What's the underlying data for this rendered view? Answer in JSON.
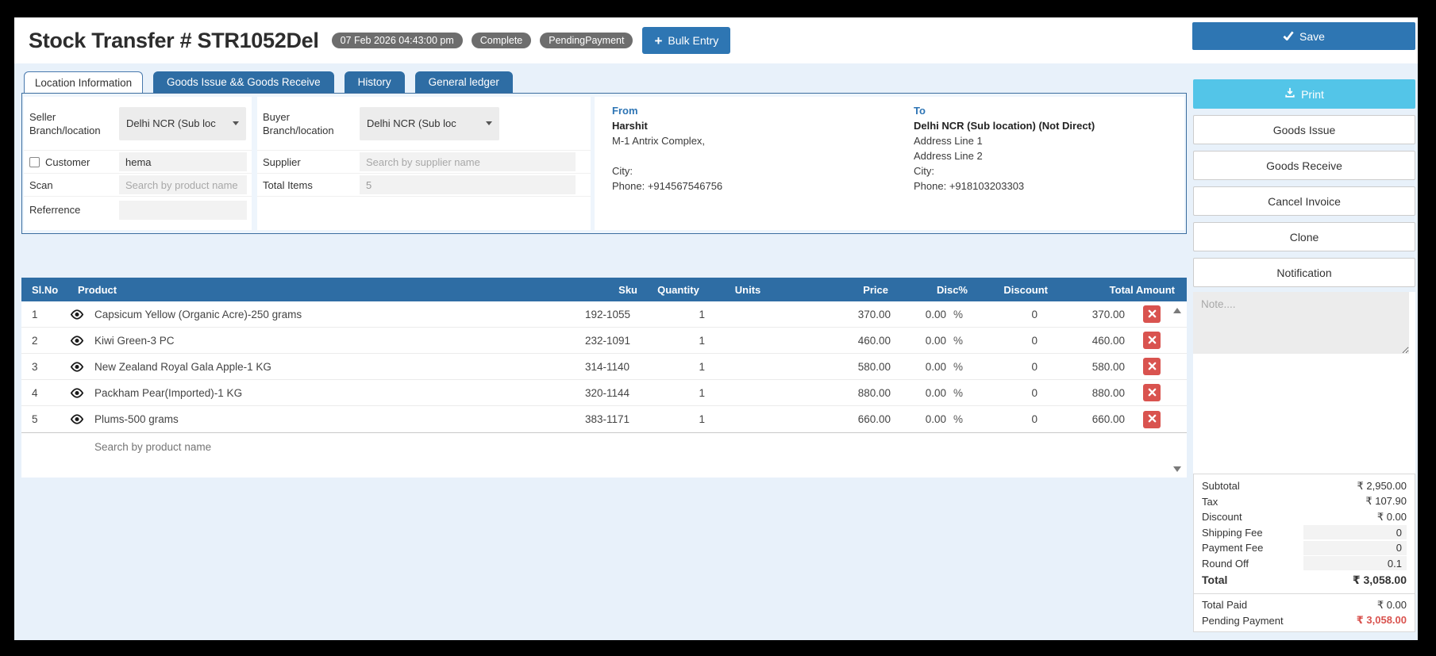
{
  "header": {
    "title": "Stock Transfer # STR1052Del",
    "badges": [
      "07 Feb 2026 04:43:00 pm",
      "Complete",
      "PendingPayment"
    ],
    "bulk_entry_label": "Bulk Entry",
    "save_label": "Save"
  },
  "tabs": [
    {
      "label": "Location Information",
      "active": true
    },
    {
      "label": "Goods Issue && Goods Receive",
      "active": false
    },
    {
      "label": "History",
      "active": false
    },
    {
      "label": "General ledger",
      "active": false
    }
  ],
  "form": {
    "seller": {
      "label_line1": "Seller",
      "label_line2": "Branch/location",
      "value": "Delhi NCR (Sub loc"
    },
    "buyer": {
      "label_line1": "Buyer",
      "label_line2": "Branch/location",
      "value": "Delhi NCR (Sub loc"
    },
    "customer": {
      "label": "Customer",
      "checked": false,
      "value": "hema"
    },
    "scan": {
      "label": "Scan",
      "placeholder": "Search by product name"
    },
    "reference": {
      "label": "Referrence",
      "value": ""
    },
    "supplier": {
      "label": "Supplier",
      "placeholder": "Search by supplier name"
    },
    "total_items": {
      "label": "Total Items",
      "value": "5"
    }
  },
  "addresses": {
    "from": {
      "heading": "From",
      "name": "Harshit",
      "line1": "M-1 Antrix Complex,",
      "line2": "",
      "city": "City:",
      "phone": "Phone: +914567546756"
    },
    "to": {
      "heading": "To",
      "name": "Delhi NCR (Sub location) (Not Direct)",
      "line1": "Address Line 1",
      "line2": "Address Line 2",
      "city": "City:",
      "phone": "Phone: +918103203303"
    }
  },
  "table": {
    "columns": {
      "slno": "Sl.No",
      "product": "Product",
      "sku": "Sku",
      "quantity": "Quantity",
      "units": "Units",
      "price": "Price",
      "disc": "Disc%",
      "discount": "Discount",
      "total": "Total Amount"
    },
    "percent": "%",
    "rows": [
      {
        "slno": "1",
        "product": "Capsicum Yellow (Organic Acre)-250 grams",
        "sku": "192-1055",
        "quantity": "1",
        "price": "370.00",
        "disc": "0.00",
        "discount": "0",
        "total": "370.00"
      },
      {
        "slno": "2",
        "product": "Kiwi Green-3 PC",
        "sku": "232-1091",
        "quantity": "1",
        "price": "460.00",
        "disc": "0.00",
        "discount": "0",
        "total": "460.00"
      },
      {
        "slno": "3",
        "product": "New Zealand Royal Gala Apple-1 KG",
        "sku": "314-1140",
        "quantity": "1",
        "price": "580.00",
        "disc": "0.00",
        "discount": "0",
        "total": "580.00"
      },
      {
        "slno": "4",
        "product": "Packham Pear(Imported)-1 KG",
        "sku": "320-1144",
        "quantity": "1",
        "price": "880.00",
        "disc": "0.00",
        "discount": "0",
        "total": "880.00"
      },
      {
        "slno": "5",
        "product": "Plums-500 grams",
        "sku": "383-1171",
        "quantity": "1",
        "price": "660.00",
        "disc": "0.00",
        "discount": "0",
        "total": "660.00"
      }
    ],
    "search_placeholder": "Search by product name"
  },
  "sidebar": {
    "print_label": "Print",
    "actions": [
      "Goods Issue",
      "Goods Receive",
      "Cancel Invoice",
      "Clone",
      "Notification"
    ],
    "note_placeholder": "Note....",
    "totals": {
      "subtotal": {
        "label": "Subtotal",
        "value": "₹ 2,950.00"
      },
      "tax": {
        "label": "Tax",
        "value": "₹ 107.90"
      },
      "discount": {
        "label": "Discount",
        "value": "₹ 0.00"
      },
      "shipping": {
        "label": "Shipping Fee",
        "value": "0"
      },
      "payment_fee": {
        "label": "Payment Fee",
        "value": "0"
      },
      "round_off": {
        "label": "Round Off",
        "value": "0.1"
      },
      "total": {
        "label": "Total",
        "value": "₹ 3,058.00"
      }
    },
    "payment": {
      "total_paid": {
        "label": "Total Paid",
        "value": "₹ 0.00"
      },
      "pending": {
        "label": "Pending Payment",
        "value": "₹ 3,058.00"
      }
    }
  },
  "icons": {
    "save": "check-icon",
    "bulk_entry": "plus-icon",
    "print": "download-icon",
    "row_view": "eye-icon",
    "row_delete": "x-icon",
    "dropdown": "caret-down-icon",
    "scroll": "triangle-up-down-icons"
  },
  "colors": {
    "accent_blue": "#2e6da4",
    "button_blue": "#2e76b3",
    "print_cyan": "#53c5e8",
    "danger_red": "#d9534f",
    "badge_gray": "#6d6d6d",
    "page_bg": "#e8f1fa"
  }
}
